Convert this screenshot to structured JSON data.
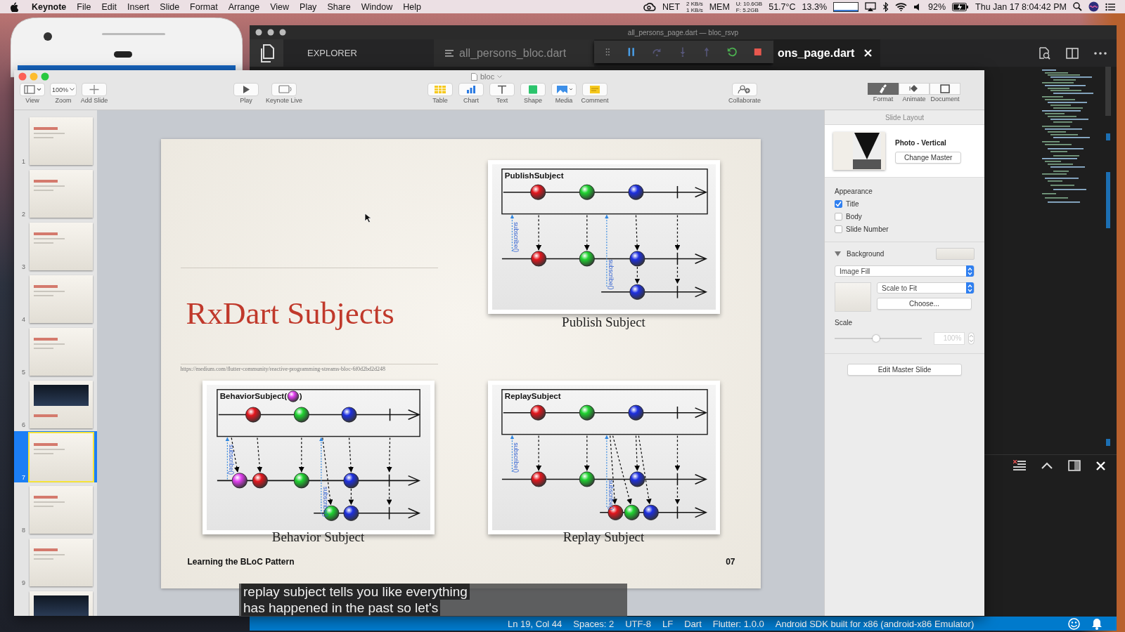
{
  "menu_bar": {
    "app": "Keynote",
    "menus": [
      "File",
      "Edit",
      "Insert",
      "Slide",
      "Format",
      "Arrange",
      "View",
      "Play",
      "Share",
      "Window",
      "Help"
    ],
    "status": {
      "net_label": "NET",
      "net_in": "2 KB/s",
      "net_out": "1 KB/s",
      "mem_label": "MEM",
      "mem_used": "U: 10.6GB",
      "mem_free": "F: 5.2GB",
      "temperature": "51.7°C",
      "cpu": "13.3%",
      "battery": "92%",
      "clock": "Thu Jan 17  8:04:42 PM"
    }
  },
  "code_editor": {
    "title": "all_persons_page.dart — bloc_rsvp",
    "sidebar_title": "EXPLORER",
    "tabs": [
      {
        "label": "all_persons_bloc.dart",
        "selected": false
      },
      {
        "label": "ons_page.dart",
        "selected": true
      }
    ],
    "status_items": [
      "Ln 19, Col 44",
      "Spaces: 2",
      "UTF-8",
      "LF",
      "Dart",
      "Flutter: 1.0.0",
      "Android SDK built for x86 (android-x86 Emulator)"
    ]
  },
  "keynote": {
    "title": "bloc",
    "toolbar_groups": [
      {
        "items": [
          {
            "label": "View",
            "kind": "view"
          },
          {
            "label": "Zoom",
            "kind": "zoom",
            "value": "100%"
          },
          {
            "label": "Add Slide",
            "kind": "add"
          }
        ]
      },
      {
        "items": [
          {
            "label": "Play",
            "kind": "play"
          },
          {
            "label": "Keynote Live",
            "kind": "live"
          }
        ]
      },
      {
        "items": [
          {
            "label": "Table",
            "kind": "table"
          },
          {
            "label": "Chart",
            "kind": "chart"
          },
          {
            "label": "Text",
            "kind": "text"
          },
          {
            "label": "Shape",
            "kind": "shape"
          },
          {
            "label": "Media",
            "kind": "media"
          },
          {
            "label": "Comment",
            "kind": "comment"
          }
        ]
      },
      {
        "items": [
          {
            "label": "Collaborate",
            "kind": "collaborate"
          }
        ]
      }
    ],
    "inspector_tabs": [
      {
        "label": "Format",
        "kind": "format",
        "selected": true
      },
      {
        "label": "Animate",
        "kind": "animate",
        "selected": false
      },
      {
        "label": "Document",
        "kind": "document",
        "selected": false
      }
    ],
    "slides": [
      {
        "number": "1",
        "kind": "light",
        "selected": false
      },
      {
        "number": "2",
        "kind": "light",
        "selected": false
      },
      {
        "number": "3",
        "kind": "light",
        "selected": false
      },
      {
        "number": "4",
        "kind": "light",
        "selected": false
      },
      {
        "number": "5",
        "kind": "light",
        "selected": false
      },
      {
        "number": "6",
        "kind": "dark",
        "selected": false
      },
      {
        "number": "7",
        "kind": "light",
        "selected": true
      },
      {
        "number": "8",
        "kind": "light",
        "selected": false
      },
      {
        "number": "9",
        "kind": "light",
        "selected": false
      },
      {
        "kind": "dark",
        "selected": false
      }
    ],
    "slide": {
      "title": "RxDart Subjects",
      "source_url": "https://medium.com/flutter-community/reactive-programming-streams-bloc-6f0d2bd2d248",
      "footer": "Learning the BLoC Pattern",
      "slide_number": "07",
      "diagrams": [
        {
          "kind": "publish",
          "title": "PublishSubject",
          "caption": "Publish Subject",
          "subscribe_labels": [
            "subscribe()",
            "subscribe()"
          ]
        },
        {
          "kind": "behavior",
          "title": "BehaviorSubject(",
          "title_suffix": ")",
          "caption": "Behavior Subject",
          "subscribe_labels": [
            "subscribe()",
            "subscribe()"
          ]
        },
        {
          "kind": "replay",
          "title": "ReplaySubject",
          "caption": "Replay Subject",
          "subscribe_labels": [
            "subscribe()",
            "subscribe()"
          ]
        }
      ]
    },
    "inspector": {
      "header": "Slide Layout",
      "layout_name": "Photo - Vertical",
      "change_master": "Change Master",
      "appearance_title": "Appearance",
      "appearance": [
        {
          "label": "Title",
          "checked": true
        },
        {
          "label": "Body",
          "checked": false
        },
        {
          "label": "Slide Number",
          "checked": false
        }
      ],
      "background": {
        "label": "Background",
        "expanded": true,
        "fill": "Image Fill",
        "scaling": "Scale to Fit",
        "choose": "Choose..."
      },
      "scale": {
        "label": "Scale",
        "level": 0.48,
        "value": "100%",
        "disabled": true
      },
      "edit_master": "Edit Master Slide"
    }
  },
  "caption": {
    "lines": [
      "replay subject tells you like everything",
      "has happened in the past so let's"
    ]
  }
}
